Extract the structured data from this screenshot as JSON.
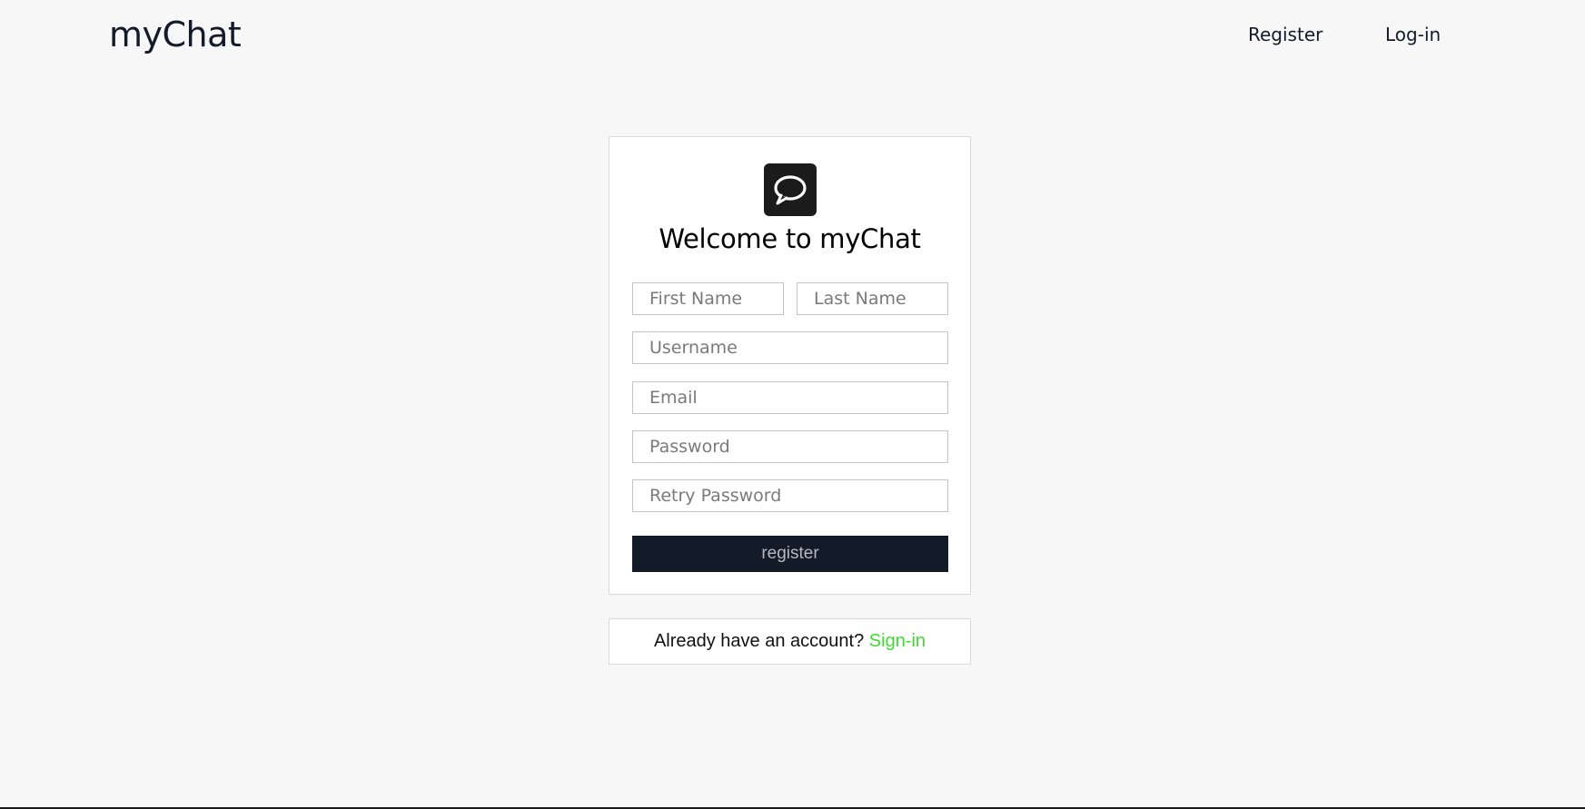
{
  "header": {
    "brand": "myChat",
    "nav": {
      "register": "Register",
      "login": "Log-in"
    }
  },
  "form": {
    "logo_icon": "chat-bubble-icon",
    "title": "Welcome to myChat",
    "fields": {
      "first_name": {
        "placeholder": "First Name",
        "value": ""
      },
      "last_name": {
        "placeholder": "Last Name",
        "value": ""
      },
      "username": {
        "placeholder": "Username",
        "value": ""
      },
      "email": {
        "placeholder": "Email",
        "value": ""
      },
      "password": {
        "placeholder": "Password",
        "value": ""
      },
      "retry_password": {
        "placeholder": "Retry Password",
        "value": ""
      }
    },
    "submit_label": "register"
  },
  "signin": {
    "prompt": "Already have an account?",
    "link": "Sign-in"
  },
  "colors": {
    "background": "#f7f7f7",
    "button": "#131a28",
    "link": "#3ddc2f"
  }
}
